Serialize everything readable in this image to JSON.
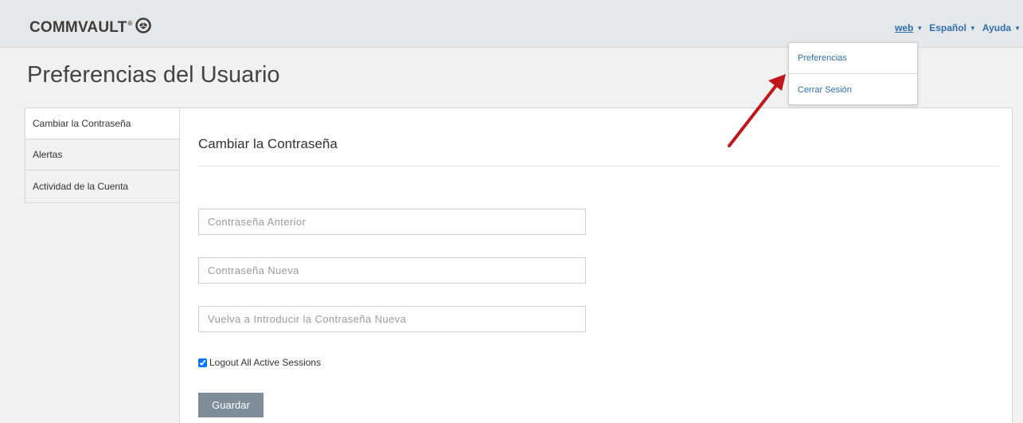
{
  "header": {
    "logo_text": "COMMVAULT",
    "logo_tm": "®",
    "user_menu": "web",
    "language_menu": "Español",
    "help_menu": "Ayuda"
  },
  "page": {
    "title": "Preferencias del Usuario"
  },
  "sidebar": {
    "items": [
      {
        "label": "Cambiar la Contraseña",
        "active": true
      },
      {
        "label": "Alertas",
        "active": false
      },
      {
        "label": "Actividad de la Cuenta",
        "active": false
      }
    ]
  },
  "form": {
    "title": "Cambiar la Contraseña",
    "old_password_placeholder": "Contraseña Anterior",
    "new_password_placeholder": "Contraseña Nueva",
    "confirm_password_placeholder": "Vuelva a Introducir la Contraseña Nueva",
    "logout_label": "Logout All Active Sessions",
    "logout_checked": true,
    "save_label": "Guardar"
  },
  "user_dropdown": {
    "items": [
      "Preferencias",
      "Cerrar Sesión"
    ]
  },
  "colors": {
    "accent": "#2f6ea8",
    "annotation_arrow": "#c0171d",
    "save_button": "#7d8d9a"
  },
  "icons": {
    "logo_mark": "commvault-logo-icon",
    "menu_caret": "caret-down-icon"
  }
}
